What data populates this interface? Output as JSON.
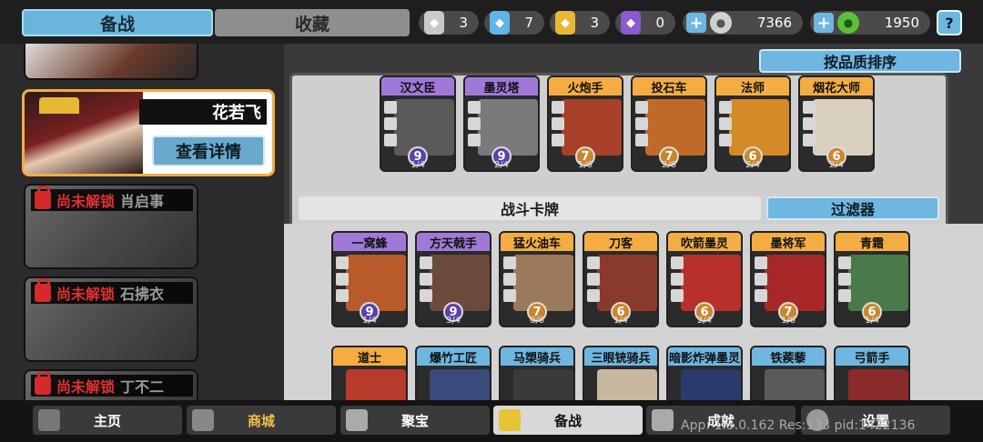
{
  "top": {
    "tabs": [
      "备战",
      "收藏"
    ],
    "resources": [
      {
        "icon": "silver-badge-icon",
        "value": "3",
        "color": "#c9c9c9"
      },
      {
        "icon": "blue-crystal-icon",
        "value": "7",
        "color": "#5fb4e8"
      },
      {
        "icon": "gold-badge-icon",
        "value": "3",
        "color": "#e6b833"
      },
      {
        "icon": "purple-badge-icon",
        "value": "0",
        "color": "#8a5ad0"
      }
    ],
    "silver_coins": "7366",
    "green_coins": "1950"
  },
  "heroes": {
    "selected": {
      "name": "花若飞",
      "detail_label": "查看详情"
    },
    "locked": [
      {
        "lock_label": "尚未解锁",
        "name": "肖启事"
      },
      {
        "lock_label": "尚未解锁",
        "name": "石拂衣"
      },
      {
        "lock_label": "尚未解锁",
        "name": "丁不二"
      }
    ]
  },
  "panel": {
    "sort_label": "按品质排序",
    "battle_cards_label": "战斗卡牌",
    "filter_label": "过滤器"
  },
  "deck": [
    {
      "name": "汉文臣",
      "level": "9",
      "count": "1/4",
      "rarity": "purple",
      "art": "#5a5a5a"
    },
    {
      "name": "墨灵塔",
      "level": "9",
      "count": "2/4",
      "rarity": "purple",
      "art": "#7a7a7a"
    },
    {
      "name": "火炮手",
      "level": "7",
      "count": "1/6",
      "rarity": "orange",
      "art": "#a8402a"
    },
    {
      "name": "投石车",
      "level": "7",
      "count": "2/6",
      "rarity": "orange",
      "art": "#c06a2a"
    },
    {
      "name": "法师",
      "level": "6",
      "count": "2/4",
      "rarity": "orange",
      "art": "#d58a28"
    },
    {
      "name": "烟花大师",
      "level": "6",
      "count": "2/4",
      "rarity": "orange",
      "art": "#d9d0c0"
    }
  ],
  "collection_row1": [
    {
      "name": "一窝蜂",
      "level": "9",
      "count": "1/4",
      "rarity": "purple",
      "art": "#b85a2a"
    },
    {
      "name": "方天戟手",
      "level": "9",
      "count": "3/4",
      "rarity": "purple",
      "art": "#6a4a3a"
    },
    {
      "name": "猛火油车",
      "level": "7",
      "count": "0/6",
      "rarity": "orange",
      "art": "#9a7a5a"
    },
    {
      "name": "刀客",
      "level": "6",
      "count": "1/4",
      "rarity": "orange",
      "art": "#8a3a2a"
    },
    {
      "name": "吹箭墨灵",
      "level": "6",
      "count": "2/4",
      "rarity": "orange",
      "art": "#b8302a"
    },
    {
      "name": "墨将军",
      "level": "7",
      "count": "1/6",
      "rarity": "orange",
      "art": "#a82828"
    },
    {
      "name": "青霜",
      "level": "6",
      "count": "1/4",
      "rarity": "orange",
      "art": "#4a7a4a"
    }
  ],
  "collection_row2": [
    {
      "name": "道士",
      "rarity": "orange",
      "art": "#b83a2a"
    },
    {
      "name": "爆竹工匠",
      "rarity": "blue",
      "art": "#3a4a7a"
    },
    {
      "name": "马槊骑兵",
      "rarity": "blue",
      "art": "#3a3a3a"
    },
    {
      "name": "三眼铳骑兵",
      "rarity": "blue",
      "art": "#c8b8a0"
    },
    {
      "name": "暗影炸弹墨灵",
      "rarity": "blue",
      "art": "#2a3a6a"
    },
    {
      "name": "铁蒺藜",
      "rarity": "blue",
      "art": "#5a5a5a"
    },
    {
      "name": "弓箭手",
      "rarity": "blue",
      "art": "#8a2a2a"
    }
  ],
  "nav": [
    {
      "label": "主页",
      "icon": "home-icon",
      "state": "normal"
    },
    {
      "label": "商城",
      "icon": "shop-icon",
      "state": "gold"
    },
    {
      "label": "聚宝",
      "icon": "treasure-icon",
      "state": "normal"
    },
    {
      "label": "备战",
      "icon": "cards-icon",
      "state": "active"
    },
    {
      "label": "成就",
      "icon": "achievement-icon",
      "state": "normal"
    },
    {
      "label": "设置",
      "icon": "gear-icon",
      "state": "normal"
    }
  ],
  "debug": "App: 1.3.0.162 Res:133 pid:1422136"
}
